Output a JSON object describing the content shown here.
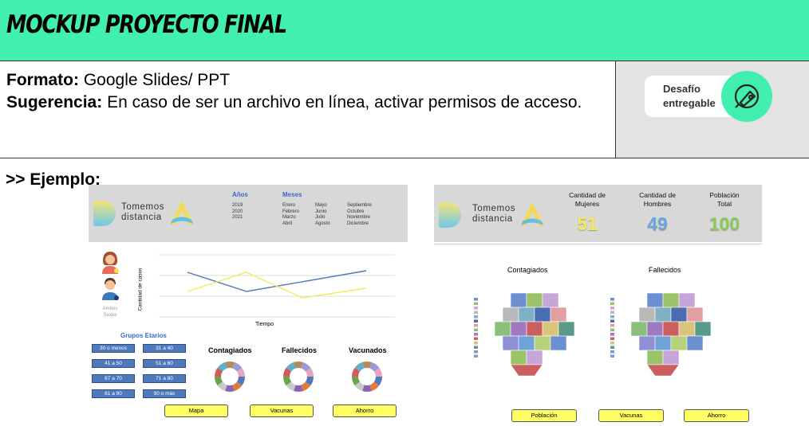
{
  "header": {
    "title": "MOCKUP PROYECTO FINAL"
  },
  "info": {
    "format_label": "Formato:",
    "format_value": "Google Slides/ PPT",
    "suggest_label": "Sugerencia:",
    "suggest_value": "En caso de ser un archivo en línea, activar permisos de acceso."
  },
  "badge": {
    "line1": "Desafío",
    "line2": "entregable"
  },
  "example_label": ">> Ejemplo:",
  "colors": {
    "header_bg": "#41efae",
    "badge_bg": "#e3e3e3",
    "button_yellow": "#ffff63",
    "group_blue": "#4f79bd"
  },
  "slide1": {
    "logo": {
      "line1": "Tomemos",
      "line2": "distancia"
    },
    "years_title": "Años",
    "years": [
      "2019",
      "2020",
      "2021"
    ],
    "months_title": "Meses",
    "months": [
      "Enero",
      "Febrero",
      "Marzo",
      "Abril",
      "Mayo",
      "Junio",
      "Julio",
      "Agosto",
      "Septiembre",
      "Octubre",
      "Noviembre",
      "Diciembre"
    ],
    "sex_label_1": "Ambos",
    "sex_label_2": "Sexos",
    "y_axis": "Cantidad de casos",
    "x_axis": "Tiempo",
    "groups_title": "Grupos Etarios",
    "groups": [
      "30 o menos",
      "31 a 40",
      "41 a 50",
      "51 a 60",
      "67 a 70",
      "71 a 80",
      "81 a 90",
      "90 o más"
    ],
    "donuts": [
      "Contagiados",
      "Fallecidos",
      "Vacunados"
    ],
    "buttons": [
      "Mapa",
      "Vacunas",
      "Ahorro"
    ]
  },
  "slide2": {
    "logo": {
      "line1": "Tomemos",
      "line2": "distancia"
    },
    "stats": [
      {
        "label1": "Cantidad de",
        "label2": "Mujeres",
        "value": "51",
        "color": "#f2ec5a"
      },
      {
        "label1": "Cantidad de",
        "label2": "Hombres",
        "value": "49",
        "color": "#6aa7e0"
      },
      {
        "label1": "Población",
        "label2": "Total",
        "value": "100",
        "color": "#8cc95a"
      }
    ],
    "maps": [
      "Contagiados",
      "Fallecidos"
    ],
    "buttons": [
      "Población",
      "Vacunas",
      "Ahorro"
    ]
  }
}
